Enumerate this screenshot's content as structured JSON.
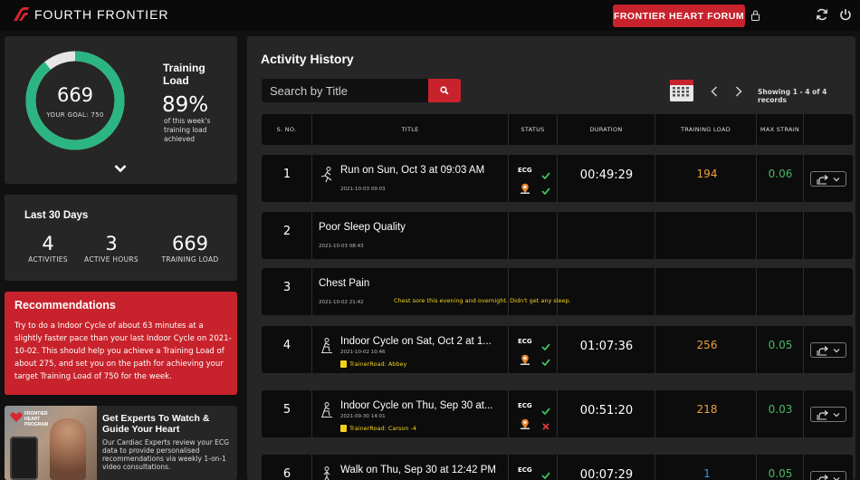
{
  "app": {
    "brand": "FOURTH FRONTIER",
    "forum_button": "FRONTIER HEART FORUM",
    "icons": [
      "lock-icon",
      "refresh-icon",
      "power-icon"
    ],
    "colors": {
      "accent": "#c8232c",
      "ring": "#2bb582",
      "orange": "#f0a13b",
      "green": "#48b86a",
      "blue": "#3a9bd8",
      "yellow": "#f2d21b"
    }
  },
  "training_load": {
    "value": "669",
    "goal": "YOUR GOAL: 750",
    "progress": 0.892,
    "title": "Training Load",
    "percent": "89%",
    "description": "of this week's training load achieved"
  },
  "last30": {
    "title": "Last 30 Days",
    "stats": [
      {
        "value": "4",
        "label": "ACTIVITIES"
      },
      {
        "value": "3",
        "label": "ACTIVE HOURS"
      },
      {
        "value": "669",
        "label": "TRAINING LOAD"
      }
    ]
  },
  "recommendations": {
    "title": "Recommendations",
    "text": "Try to do a Indoor Cycle of about 63 minutes at a slightly faster pace than your last Indoor Cycle on 2021-10-02. This should help you achieve a Training Load of about 275, and set you on the path for achieving your target Training Load of 750 for the week."
  },
  "promo": {
    "logo_text": "FRONTIER HEART PROGRAM",
    "title": "Get Experts To Watch & Guide Your Heart",
    "text": "Our Cardiac Experts review your ECG data to provide personalised recommendations via weekly 1-on-1 video consultations."
  },
  "activity": {
    "title": "Activity History",
    "search_placeholder": "Search by Title",
    "showing": "Showing 1 - 4 of 4 records",
    "columns": [
      "S. NO.",
      "TITLE",
      "STATUS",
      "DURATION",
      "TRAINING LOAD",
      "MAX STRAIN"
    ],
    "rows": [
      {
        "sno": "1",
        "title": "Run on Sun, Oct 3 at 09:03 AM",
        "date": "2021-10-03 09:03",
        "note": "",
        "sub": "",
        "status_label": "ECG",
        "ecg_ok": true,
        "gps_ok": true,
        "duration": "00:49:29",
        "training_load": "194",
        "max_strain": "0.06",
        "load_color": "#f0a13b",
        "strain_color": "#48b86a",
        "icon": "run-icon",
        "has_status": true
      },
      {
        "sno": "2",
        "title": "Poor Sleep Quality",
        "date": "2021-10-03 08:43",
        "note": "",
        "sub": "",
        "has_status": false
      },
      {
        "sno": "3",
        "title": "Chest Pain",
        "date": "2021-10-02 21:42",
        "note": "Chest sore this evening and overnight. Didn't get any sleep.",
        "sub": "",
        "has_status": false
      },
      {
        "sno": "4",
        "title": "Indoor Cycle on Sat, Oct 2 at 1...",
        "date": "2021-10-02 10:46",
        "note": "",
        "sub": "TrainerRoad: Abbey",
        "status_label": "ECG",
        "ecg_ok": true,
        "gps_ok": true,
        "duration": "01:07:36",
        "training_load": "256",
        "max_strain": "0.05",
        "load_color": "#f0a13b",
        "strain_color": "#48b86a",
        "icon": "cycle-icon",
        "has_status": true
      },
      {
        "sno": "5",
        "title": "Indoor Cycle on Thu, Sep 30 at...",
        "date": "2021-09-30 14:01",
        "note": "",
        "sub": "TrainerRoad: Carson -4",
        "status_label": "ECG",
        "ecg_ok": true,
        "gps_ok": false,
        "duration": "00:51:20",
        "training_load": "218",
        "max_strain": "0.03",
        "load_color": "#f0a13b",
        "strain_color": "#48b86a",
        "icon": "cycle-icon",
        "has_status": true
      },
      {
        "sno": "6",
        "title": "Walk on Thu, Sep 30 at 12:42 PM",
        "date": "",
        "note": "",
        "sub": "",
        "status_label": "ECG",
        "ecg_ok": true,
        "gps_ok": true,
        "duration": "00:07:29",
        "training_load": "1",
        "max_strain": "0.05",
        "load_color": "#3a9bd8",
        "strain_color": "#48b86a",
        "icon": "walk-icon",
        "has_status": true
      }
    ]
  }
}
